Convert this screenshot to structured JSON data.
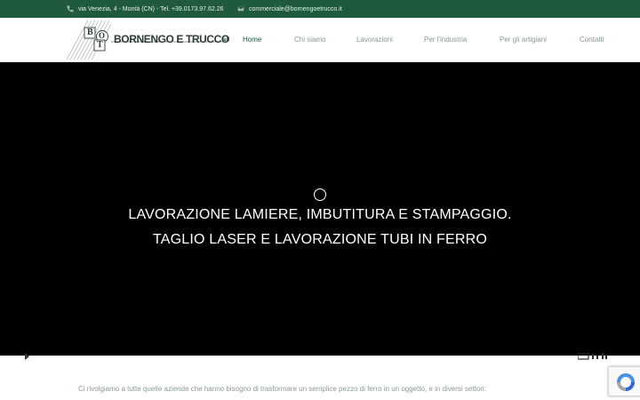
{
  "topbar": {
    "address": "via Venezia, 4 - Montà (CN) - Tel. +39.0173.97.62.26",
    "email": "commerciale@bornengoetrucco.it"
  },
  "logo": {
    "name": "BORNENGO E TRUCCO",
    "suffix": "srl",
    "letters": [
      "B",
      "O",
      "T"
    ]
  },
  "nav": [
    {
      "label": "Home",
      "active": true
    },
    {
      "label": "Chi siamo"
    },
    {
      "label": "Lavorazioni"
    },
    {
      "label": "Per l'industria"
    },
    {
      "label": "Per gli artigiani"
    },
    {
      "label": "Contatti"
    }
  ],
  "hero": {
    "line1": "LAVORAZIONE LAMIERE, IMBUTITURA E STAMPAGGIO.",
    "line2": "TAGLIO LASER E LAVORAZIONE TUBI IN FERRO"
  },
  "intro": {
    "line1": "Ci rivolgiamo a tutte quelle aziende che hanno bisogno di trasformare un semplice pezzo di ferro in un oggetto, e in diversi settori:"
  },
  "colors": {
    "brand": "#1f5a3c",
    "nav_text": "#8a9a90",
    "hero_bg": "#000000"
  }
}
